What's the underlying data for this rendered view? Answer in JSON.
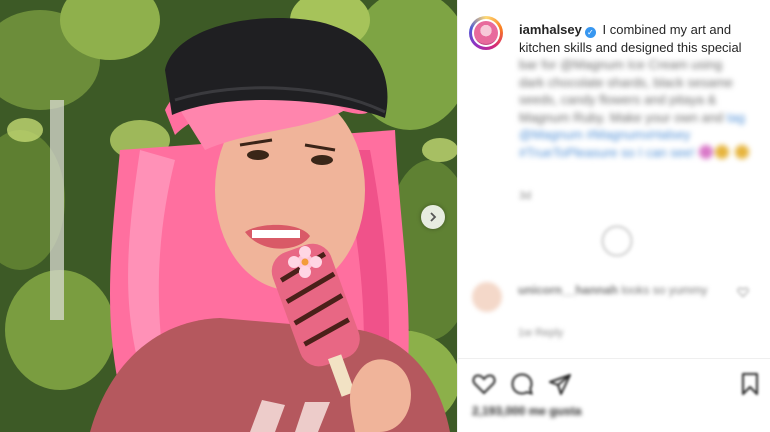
{
  "post": {
    "username": "iamhalsey",
    "verified_mark": "✓",
    "caption_visible": "I combined my art and kitchen skills and designed this special",
    "caption_blurred_lines": [
      "bar for @Magnum Ice Cream using",
      "dark chocolate shards, black sesame",
      "seeds, candy flowers and pitaya &",
      "Magnum Ruby. Make your own and",
      "tag @Magnum #MagnumxHalsey",
      "#TrueToPleasure so I can see!"
    ],
    "timestamp": "3d",
    "icons": {
      "next": "chevron-right-icon",
      "like": "heart-icon",
      "comment": "comment-icon",
      "share": "paper-plane-icon",
      "save": "bookmark-icon",
      "loading": "spinner-icon"
    }
  },
  "comment": {
    "author": "unicorn__hannah",
    "text": "looks so yummy",
    "meta": "1w   Reply"
  },
  "stats": {
    "likes": "2,193,000 me gusta"
  },
  "colors": {
    "hair": "#ff6b9d",
    "hat": "#1f1f22",
    "shirt": "#b5585e",
    "accent_link": "#4f8fd6"
  }
}
